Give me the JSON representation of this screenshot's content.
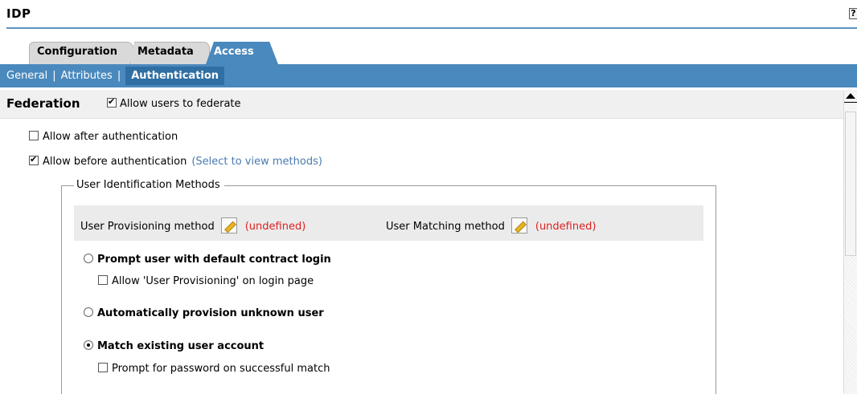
{
  "header": {
    "title": "IDP",
    "help_label": "?"
  },
  "tabs": [
    {
      "label": "Configuration",
      "active": false
    },
    {
      "label": "Metadata",
      "active": false
    },
    {
      "label": "Access",
      "active": true
    }
  ],
  "subnav": [
    {
      "label": "General",
      "active": false
    },
    {
      "label": "Attributes",
      "active": false
    },
    {
      "label": "Authentication",
      "active": true
    }
  ],
  "subnav_separator": "|",
  "federation": {
    "title": "Federation",
    "allow_label": "Allow users to federate",
    "allow_checked": true
  },
  "options": {
    "after_auth": {
      "label": "Allow after authentication",
      "checked": false
    },
    "before_auth": {
      "label": "Allow before authentication",
      "checked": true,
      "link": "(Select to view methods)"
    }
  },
  "uim": {
    "legend": "User Identification Methods",
    "provisioning": {
      "label": "User Provisioning method",
      "value": "(undefined)"
    },
    "matching": {
      "label": "User Matching method",
      "value": "(undefined)"
    },
    "choices": [
      {
        "label": "Prompt user with default contract login",
        "selected": false,
        "sub": {
          "label": "Allow 'User Provisioning' on login page",
          "checked": false
        }
      },
      {
        "label": "Automatically provision unknown user",
        "selected": false
      },
      {
        "label": "Match existing user account",
        "selected": true,
        "sub": {
          "label": "Prompt for password on successful match",
          "checked": false
        }
      }
    ]
  },
  "colors": {
    "accent": "#4a89bd",
    "accent_dark": "#2f6fa3",
    "undefined_text": "#dd2222",
    "link": "#4a7ab0"
  }
}
